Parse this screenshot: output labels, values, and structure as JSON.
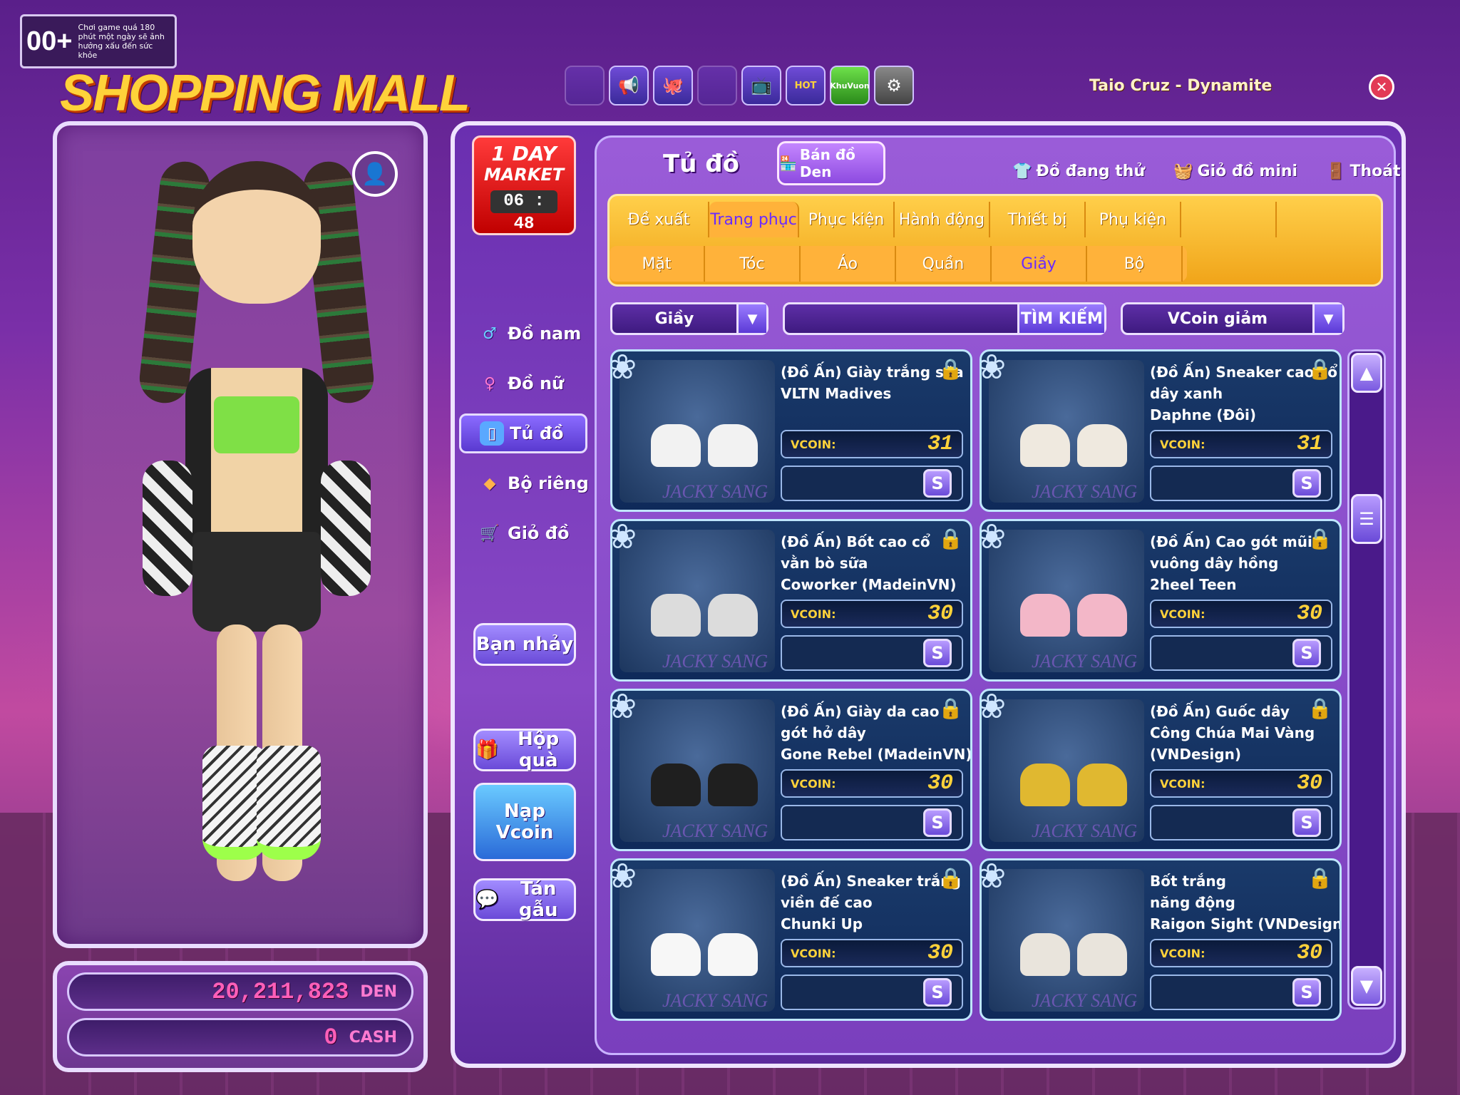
{
  "age_badge": {
    "rating": "00+",
    "notice": "Chơi game quá 180 phút một ngày sẽ ảnh hưởng xấu đến sức khỏe"
  },
  "logo_text": "SHOPPING MALL",
  "top_icons": [
    "blank-icon",
    "megaphone-icon",
    "octopus-icon",
    "blank-icon",
    "tv-icon",
    "hot-icon",
    "khu-vuon-icon",
    "wheel-icon"
  ],
  "top_icon_labels": {
    "hot": "HOT",
    "khu_vuon": "KhuVuon"
  },
  "now_playing": "Taio Cruz - Dynamite",
  "currency": {
    "den_value": "20,211,823",
    "den_unit": "DEN",
    "cash_value": "0",
    "cash_unit": "CASH"
  },
  "market": {
    "line1": "1 DAY",
    "line2": "MARKET",
    "timer": "06 : 48"
  },
  "left_nav": [
    {
      "label": "Đồ nam",
      "icon": "male-icon"
    },
    {
      "label": "Đồ nữ",
      "icon": "female-icon"
    },
    {
      "label": "Tủ đồ",
      "icon": "wardrobe-icon",
      "active": true
    },
    {
      "label": "Bộ riêng",
      "icon": "set-icon"
    },
    {
      "label": "Giỏ đồ",
      "icon": "cart-icon"
    }
  ],
  "side_buttons": {
    "ban_nhay": "Bạn nhảy",
    "hop_qua": "Hộp quà",
    "nap_vcoin": "Nạp Vcoin",
    "tan_gau": "Tán gẫu"
  },
  "content": {
    "title": "Tủ đồ",
    "ban_do_den": "Bán đồ Den",
    "actions": {
      "trying": "Đồ đang thử",
      "mini_cart": "Giỏ đồ mini",
      "exit": "Thoát"
    }
  },
  "tabs_row1": [
    "Đề xuất",
    "Trang phục",
    "Phục kiện",
    "Hành động",
    "Thiết bị",
    "Phụ kiện",
    "",
    ""
  ],
  "tabs_row2": [
    "Mặt",
    "Tóc",
    "Áo",
    "Quần",
    "Giầy",
    "Bộ",
    "",
    ""
  ],
  "filters": {
    "category": "Giầy",
    "search_label": "TÌM KIẾM",
    "search_value": "",
    "sort": "VCoin giảm"
  },
  "items": [
    {
      "name_l1": "(Đồ Ấn) Giày trắng sữa",
      "name_l2": "VLTN Madives",
      "name_l3": "",
      "price": "31",
      "currency": "VCOIN:",
      "sell": "S",
      "brand": "JACKY SANG",
      "shoe_color": "#f2f2f2"
    },
    {
      "name_l1": "(Đồ Ấn) Sneaker cao cổ",
      "name_l2": "dây xanh",
      "name_l3": "Daphne (Đôi)",
      "price": "31",
      "currency": "VCOIN:",
      "sell": "S",
      "brand": "JACKY SANG",
      "shoe_color": "#efe9df"
    },
    {
      "name_l1": "(Đồ Ấn) Bốt cao cổ",
      "name_l2": "vằn bò sữa",
      "name_l3": "Coworker (MadeinVN)",
      "price": "30",
      "currency": "VCOIN:",
      "sell": "S",
      "brand": "JACKY SANG",
      "shoe_color": "#dcdcdc"
    },
    {
      "name_l1": "(Đồ Ấn) Cao gót mũi",
      "name_l2": "vuông dây hồng",
      "name_l3": "2heel Teen",
      "price": "30",
      "currency": "VCOIN:",
      "sell": "S",
      "brand": "JACKY SANG",
      "shoe_color": "#f3b7c8"
    },
    {
      "name_l1": "(Đồ Ấn) Giày da cao",
      "name_l2": "gót hở dây",
      "name_l3": "Gone Rebel (MadeinVN)",
      "price": "30",
      "currency": "VCOIN:",
      "sell": "S",
      "brand": "JACKY SANG",
      "shoe_color": "#1f1f1f"
    },
    {
      "name_l1": "(Đồ Ấn) Guốc dây",
      "name_l2": "Công Chúa Mai Vàng",
      "name_l3": "(VNDesign)",
      "price": "30",
      "currency": "VCOIN:",
      "sell": "S",
      "brand": "JACKY SANG",
      "shoe_color": "#e0b830"
    },
    {
      "name_l1": "(Đồ Ấn) Sneaker trắng",
      "name_l2": "viền đế cao",
      "name_l3": "Chunki Up",
      "price": "30",
      "currency": "VCOIN:",
      "sell": "S",
      "brand": "JACKY SANG",
      "shoe_color": "#f7f7f7"
    },
    {
      "name_l1": "Bốt trắng",
      "name_l2": "năng động",
      "name_l3": "Raigon Sight (VNDesign)",
      "price": "30",
      "currency": "VCOIN:",
      "sell": "S",
      "brand": "JACKY SANG",
      "shoe_color": "#e9e4dc"
    }
  ],
  "colors": {
    "accent": "#ffd23a",
    "panel": "#8848c6",
    "tab_bar": "#f0a419",
    "price_text": "#ffd23a",
    "currency_text": "#ff5fb8"
  }
}
